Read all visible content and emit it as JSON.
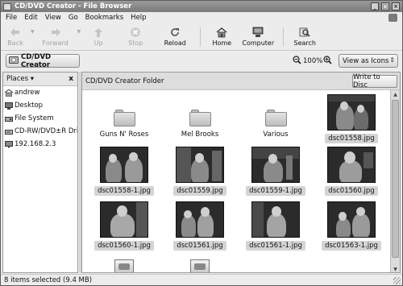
{
  "window": {
    "title": "CD/DVD Creator - File Browser"
  },
  "menu": [
    "File",
    "Edit",
    "View",
    "Go",
    "Bookmarks",
    "Help"
  ],
  "toolbar": {
    "back": "Back",
    "forward": "Forward",
    "up": "Up",
    "stop": "Stop",
    "reload": "Reload",
    "home": "Home",
    "computer": "Computer",
    "search": "Search"
  },
  "location": {
    "path_button": "CD/DVD Creator",
    "zoom": "100%",
    "view_mode": "View as Icons"
  },
  "sidebar": {
    "header": "Places",
    "close": "x",
    "items": [
      {
        "label": "andrew",
        "icon": "home-folder-icon"
      },
      {
        "label": "Desktop",
        "icon": "desktop-icon"
      },
      {
        "label": "File System",
        "icon": "harddisk-icon"
      },
      {
        "label": "CD-RW/DVD±R Drive",
        "icon": "optical-drive-icon"
      },
      {
        "label": "192.168.2.3",
        "icon": "network-icon"
      }
    ]
  },
  "main": {
    "folder_label": "CD/DVD Creator Folder",
    "write_button": "Write to Disc",
    "items": [
      {
        "label": "Guns N' Roses",
        "kind": "folder",
        "selected": false
      },
      {
        "label": "Mel Brooks",
        "kind": "folder",
        "selected": false
      },
      {
        "label": "Various",
        "kind": "folder",
        "selected": false
      },
      {
        "label": "dsc01558.jpg",
        "kind": "image",
        "selected": true
      },
      {
        "label": "dsc01558-1.jpg",
        "kind": "image",
        "selected": true
      },
      {
        "label": "dsc01559.jpg",
        "kind": "image",
        "selected": true
      },
      {
        "label": "dsc01559-1.jpg",
        "kind": "image",
        "selected": true
      },
      {
        "label": "dsc01560.jpg",
        "kind": "image",
        "selected": true
      },
      {
        "label": "dsc01560-1.jpg",
        "kind": "image",
        "selected": true
      },
      {
        "label": "dsc01561.jpg",
        "kind": "image",
        "selected": true
      },
      {
        "label": "dsc01561-1.jpg",
        "kind": "image",
        "selected": true
      },
      {
        "label": "dsc01563-1.jpg",
        "kind": "image",
        "selected": true
      }
    ]
  },
  "status": {
    "text": "8 items selected (9.4 MB)"
  }
}
